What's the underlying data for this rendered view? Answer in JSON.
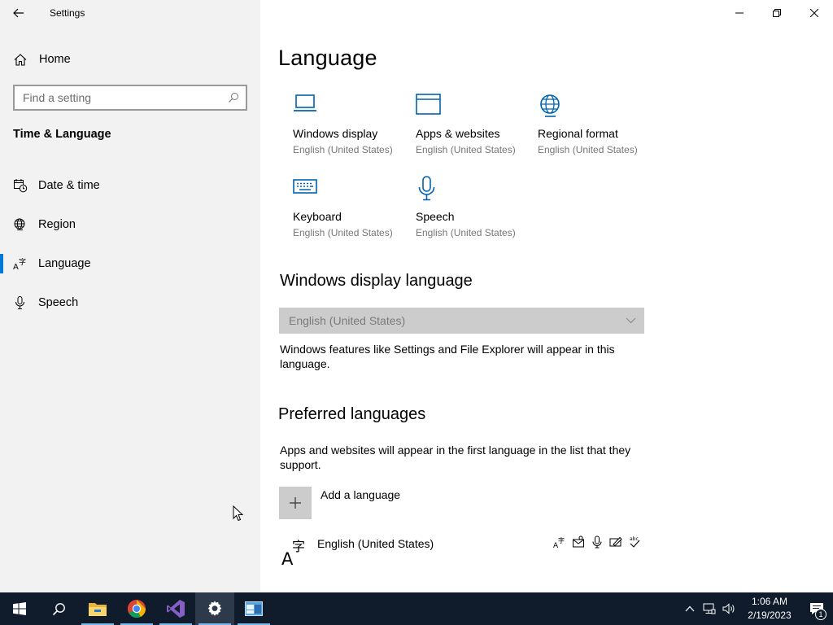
{
  "window": {
    "title": "Settings"
  },
  "sidebar": {
    "home_label": "Home",
    "search_placeholder": "Find a setting",
    "section_title": "Time & Language",
    "items": [
      {
        "label": "Date & time",
        "icon": "calendar-clock-icon",
        "active": false
      },
      {
        "label": "Region",
        "icon": "globe-icon",
        "active": false
      },
      {
        "label": "Language",
        "icon": "language-icon",
        "active": true
      },
      {
        "label": "Speech",
        "icon": "microphone-icon",
        "active": false
      }
    ]
  },
  "main": {
    "title": "Language",
    "tiles": [
      {
        "name": "Windows display",
        "sub": "English (United States)",
        "icon": "laptop-icon"
      },
      {
        "name": "Apps & websites",
        "sub": "English (United States)",
        "icon": "browser-window-icon"
      },
      {
        "name": "Regional format",
        "sub": "English (United States)",
        "icon": "globe-icon"
      },
      {
        "name": "Keyboard",
        "sub": "English (United States)",
        "icon": "keyboard-icon"
      },
      {
        "name": "Speech",
        "sub": "English (United States)",
        "icon": "microphone-icon"
      }
    ],
    "display_language": {
      "heading": "Windows display language",
      "selected": "English (United States)",
      "description": "Windows features like Settings and File Explorer will appear in this language."
    },
    "preferred": {
      "heading": "Preferred languages",
      "description": "Apps and websites will appear in the first language in the list that they support.",
      "add_label": "Add a language",
      "languages": [
        {
          "name": "English (United States)",
          "features": [
            "display-language-icon",
            "text-to-speech-icon",
            "speech-recognition-icon",
            "handwriting-icon",
            "spell-check-icon"
          ]
        }
      ]
    }
  },
  "taskbar": {
    "apps": [
      "start",
      "search",
      "file-explorer",
      "chrome",
      "visual-studio",
      "settings",
      "app"
    ],
    "time": "1:06 AM",
    "date": "2/19/2023",
    "notification_count": "1"
  },
  "colors": {
    "accent": "#0078d7",
    "sidebar_bg": "#f2f2f2",
    "taskbar_bg": "#101c2c",
    "icon_blue": "#0063b1"
  }
}
